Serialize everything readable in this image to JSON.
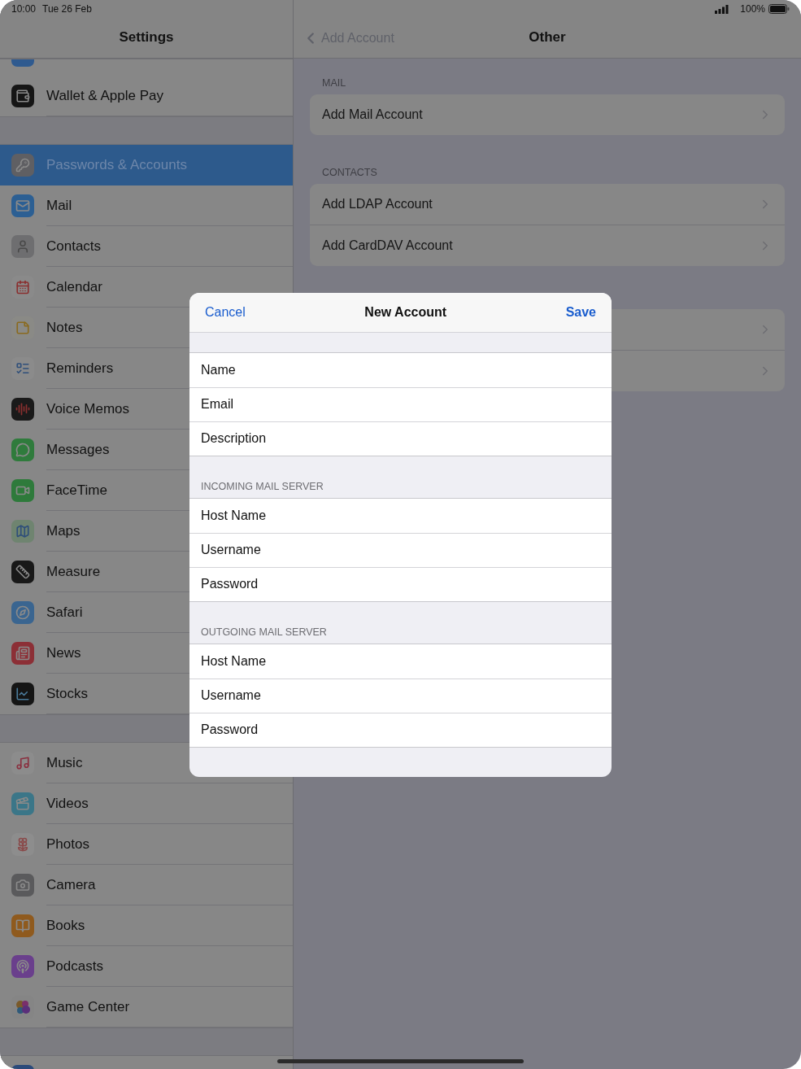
{
  "status_bar": {
    "time": "10:00",
    "date": "Tue 26 Feb",
    "battery": "100%"
  },
  "sidebar": {
    "title": "Settings",
    "groups": [
      {
        "items": [
          {
            "color": "#2f5a8f",
            "selected": false
          },
          {
            "label": "Wallet & Apple Pay",
            "color": "#161616",
            "selected": false
          }
        ]
      },
      {
        "items": [
          {
            "label": "Passwords & Accounts",
            "color": "#5f5f63",
            "selected": true
          },
          {
            "label": "Mail",
            "color": "#2c5f93",
            "selected": false
          },
          {
            "label": "Contacts",
            "color": "#6e6e70",
            "selected": false
          },
          {
            "label": "Calendar",
            "color": "#8a8a8a",
            "selected": false
          },
          {
            "label": "Notes",
            "color": "#8a8a86",
            "selected": false
          },
          {
            "label": "Reminders",
            "color": "#8b8b8b",
            "selected": false
          },
          {
            "label": "Voice Memos",
            "color": "#1a1a1a",
            "selected": false
          },
          {
            "label": "Messages",
            "color": "#2f7b3c",
            "selected": false
          },
          {
            "label": "FaceTime",
            "color": "#2e7a3b",
            "selected": false
          },
          {
            "label": "Maps",
            "color": "#6f8470",
            "selected": false
          },
          {
            "label": "Measure",
            "color": "#181818",
            "selected": false
          },
          {
            "label": "Safari",
            "color": "#3a6590",
            "selected": false
          },
          {
            "label": "News",
            "color": "#8c2f36",
            "selected": false
          },
          {
            "label": "Stocks",
            "color": "#151515",
            "selected": false
          }
        ]
      },
      {
        "items": [
          {
            "label": "Music",
            "color": "#8c8c8c",
            "selected": false
          },
          {
            "label": "Videos",
            "color": "#3b7688",
            "selected": false
          },
          {
            "label": "Photos",
            "color": "#8d8d8d",
            "selected": false
          },
          {
            "label": "Camera",
            "color": "#5a5a5c",
            "selected": false
          },
          {
            "label": "Books",
            "color": "#8f5a1e",
            "selected": false
          },
          {
            "label": "Podcasts",
            "color": "#6a3f8c",
            "selected": false
          },
          {
            "label": "Game Center",
            "color": "#858585",
            "selected": false
          }
        ]
      },
      {
        "items": [
          {
            "color": "#2b4a7a",
            "selected": false
          }
        ]
      }
    ]
  },
  "detail": {
    "back": "Add Account",
    "title": "Other",
    "sections": [
      {
        "header": "MAIL",
        "rows": [
          {
            "kind": "row",
            "label": "Add Mail Account"
          }
        ]
      },
      {
        "header": "CONTACTS",
        "rows": [
          {
            "kind": "row",
            "label": "Add LDAP Account"
          },
          {
            "kind": "row",
            "label": "Add CardDAV Account"
          }
        ]
      },
      {
        "rows": [
          {
            "kind": "row"
          },
          {
            "kind": "row"
          }
        ]
      }
    ]
  },
  "modal": {
    "cancel": "Cancel",
    "title": "New Account",
    "save": "Save",
    "sections": [
      {
        "fields": [
          {
            "label": "Name"
          },
          {
            "label": "Email"
          },
          {
            "label": "Description"
          }
        ]
      },
      {
        "header": "INCOMING MAIL SERVER",
        "fields": [
          {
            "label": "Host Name"
          },
          {
            "label": "Username"
          },
          {
            "label": "Password"
          }
        ]
      },
      {
        "header": "OUTGOING MAIL SERVER",
        "fields": [
          {
            "label": "Host Name"
          },
          {
            "label": "Username"
          },
          {
            "label": "Password"
          }
        ]
      }
    ]
  }
}
